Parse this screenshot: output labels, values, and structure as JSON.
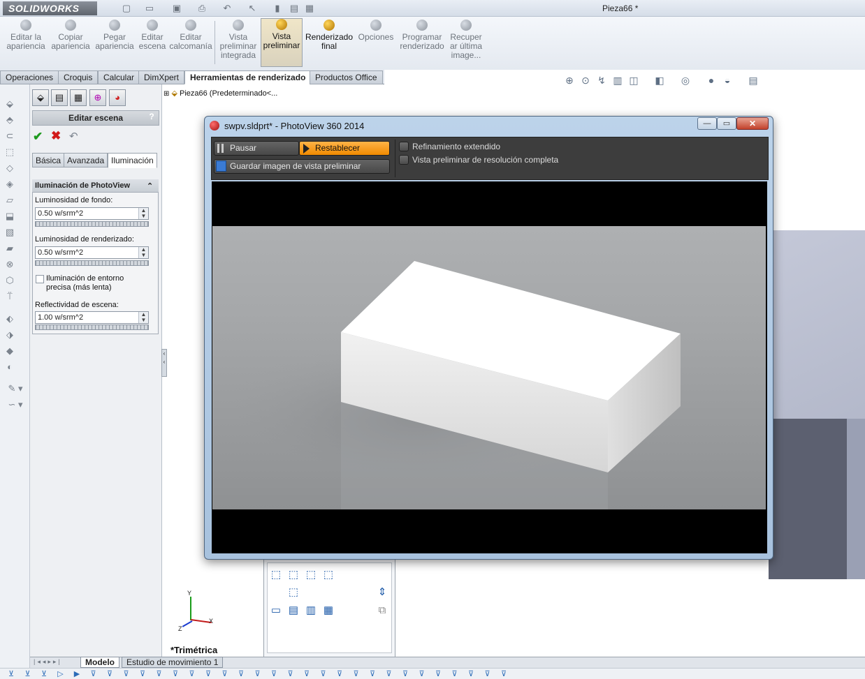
{
  "app": {
    "logo": "SOLIDWORKS",
    "document_title": "Pieza66 *"
  },
  "command_manager": {
    "buttons": [
      {
        "label": "Editar la apariencia",
        "lines": [
          "Editar la",
          "apariencia"
        ],
        "active": false
      },
      {
        "label": "Copiar apariencia",
        "lines": [
          "Copiar",
          "apariencia"
        ],
        "active": false
      },
      {
        "label": "Pegar apariencia",
        "lines": [
          "Pegar",
          "apariencia"
        ],
        "active": false
      },
      {
        "label": "Editar escena",
        "lines": [
          "Editar",
          "escena"
        ],
        "active": false
      },
      {
        "label": "Editar calcomanía",
        "lines": [
          "Editar",
          "calcomanía"
        ],
        "active": false
      },
      {
        "label": "Vista preliminar integrada",
        "lines": [
          "Vista",
          "preliminar",
          "integrada"
        ],
        "active": false
      },
      {
        "label": "Vista preliminar",
        "lines": [
          "Vista",
          "preliminar"
        ],
        "active": true
      },
      {
        "label": "Renderizado final",
        "lines": [
          "Renderizado",
          "final"
        ],
        "active": false
      },
      {
        "label": "Opciones",
        "lines": [
          "Opciones"
        ],
        "active": false
      },
      {
        "label": "Programar renderizado",
        "lines": [
          "Programar",
          "renderizado"
        ],
        "active": false
      },
      {
        "label": "Recuperar última imagen",
        "lines": [
          "Recuper",
          "ar última",
          "image..."
        ],
        "active": false
      }
    ]
  },
  "tabs": [
    {
      "label": "Operaciones"
    },
    {
      "label": "Croquis"
    },
    {
      "label": "Calcular"
    },
    {
      "label": "DimXpert"
    },
    {
      "label": "Herramientas de renderizado",
      "active": true
    },
    {
      "label": "Productos Office"
    }
  ],
  "property_manager": {
    "title": "Editar escena",
    "help": "?",
    "subtabs": [
      "Básica",
      "Avanzada",
      "Iluminación"
    ],
    "active_subtab": "Iluminación",
    "group_title": "Iluminación de PhotoView",
    "background_brightness_label": "Luminosidad de fondo:",
    "background_brightness_value": "0.50 w/srm^2",
    "render_brightness_label": "Luminosidad de renderizado:",
    "render_brightness_value": "0.50 w/srm^2",
    "accurate_env_label_1": "Iluminación de entorno",
    "accurate_env_label_2": "precisa (más lenta)",
    "accurate_env_checked": false,
    "scene_reflectivity_label": "Reflectividad de escena:",
    "scene_reflectivity_value": "1.00 w/srm^2"
  },
  "feature_tree": {
    "root": "Pieza66  (Predeterminado<..."
  },
  "viewport": {
    "view_label": "*Trimétrica",
    "triad": {
      "x": "X",
      "y": "Y",
      "z": "Z"
    }
  },
  "bottom_tabs": [
    {
      "label": "Modelo",
      "active": true
    },
    {
      "label": "Estudio de movimiento 1",
      "active": false
    }
  ],
  "photoview": {
    "title": "swpv.sldprt* - PhotoView 360 2014",
    "pause_label": "Pausar",
    "reset_label": "Restablecer",
    "save_label": "Guardar imagen de vista preliminar",
    "extended_refinement_label": "Refinamiento extendido",
    "full_resolution_label": "Vista preliminar de resolución completa",
    "colors": {
      "accent": "#f39a1e",
      "toolbar": "#3d3d3d"
    }
  }
}
